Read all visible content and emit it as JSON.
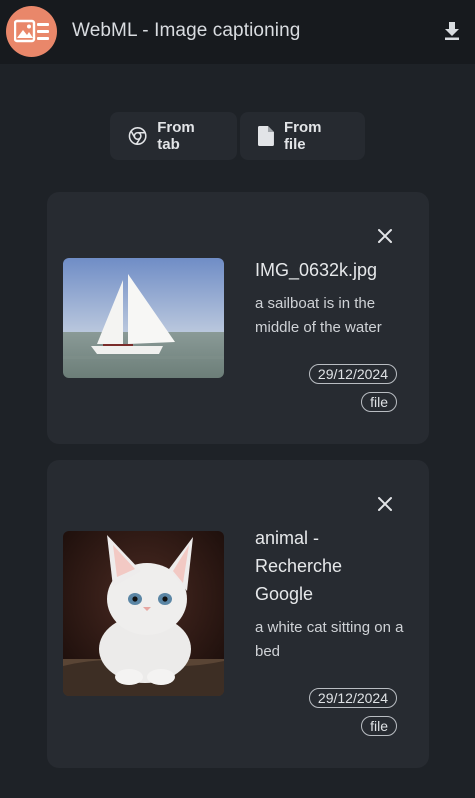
{
  "header": {
    "title": "WebML - Image captioning",
    "logo_icon": "image-list-icon",
    "download_icon": "download-icon",
    "accent": "#e9876a"
  },
  "toolbar": {
    "from_tab_label": "From tab",
    "from_tab_icon": "chrome-icon",
    "from_file_label": "From file",
    "from_file_icon": "file-icon"
  },
  "captions": [
    {
      "title": "IMG_0632k.jpg",
      "caption": "a sailboat is in the middle of the water",
      "date": "29/12/2024",
      "source": "file",
      "thumbnail_icon": "sailboat-photo"
    },
    {
      "title": "animal - Recherche Google",
      "caption": "a white cat sitting on a bed",
      "date": "29/12/2024",
      "source": "file",
      "thumbnail_icon": "cat-photo"
    }
  ]
}
